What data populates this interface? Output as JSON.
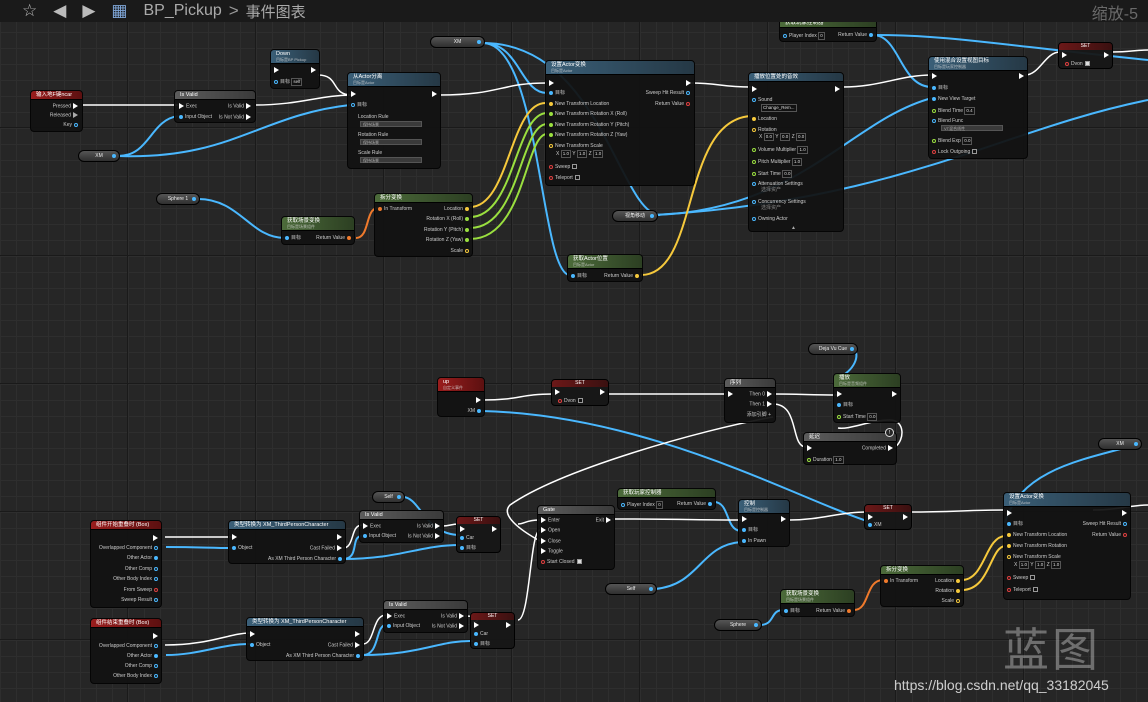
{
  "toolbar": {
    "star_icon": "star-icon",
    "back_icon": "back-arrow-icon",
    "forward_icon": "forward-arrow-icon",
    "bp_icon": "blueprint-icon",
    "title": "BP_Pickup",
    "separator": ">",
    "graph": "事件图表",
    "zoom": "缩放-5"
  },
  "nodes": {
    "key_event": {
      "title": "输入地F键ncar",
      "pressed": "Pressed",
      "released": "Released",
      "key": "Key"
    },
    "is_valid_1": {
      "title": "Is Valid",
      "exec": "Exec",
      "is_valid": "Is Valid",
      "input": "Input Object",
      "not_valid": "Is Not Valid"
    },
    "down": {
      "title": "Down",
      "sub": "目标是BP Pickup",
      "target": "目标",
      "self": "self"
    },
    "attach": {
      "title": "从Actor分离",
      "sub": "目标是Actor",
      "target": "目标",
      "loc_rule": "Location Rule",
      "rot_rule": "Rotation Rule",
      "scale_rule": "Scale Rule",
      "rule_value": "保持场景"
    },
    "set_transform": {
      "title": "设置Actor变换",
      "sub": "目标是Actor",
      "target": "目标",
      "location": "New Transform Location",
      "rot_x": "New Transform Rotation X (Roll)",
      "rot_y": "New Transform Rotation Y (Pitch)",
      "rot_z": "New Transform Rotation Z (Yaw)",
      "scale": "New Transform Scale",
      "scale_x": "1.0",
      "scale_y": "1.0",
      "scale_z": "1.0",
      "sweep": "Sweep",
      "teleport": "Teleport",
      "sweep_hit": "Sweep Hit Result",
      "ret": "Return Value"
    },
    "play_sound": {
      "title": "播放位置处的音效",
      "sound": "Sound",
      "sound_val": "Change_Rem...",
      "location": "Location",
      "rotation": "Rotation",
      "rx": "0.0",
      "ry": "0.0",
      "rz": "0.0",
      "volume": "Volume Multiplier",
      "volume_val": "1.0",
      "pitch": "Pitch Multiplier",
      "pitch_val": "1.0",
      "start": "Start Time",
      "start_val": "0.0",
      "atten": "Attenuation Settings",
      "atten_val": "选择资产",
      "concur": "Concurrency Settings",
      "concur_val": "选择资产",
      "owning": "Owning Actor"
    },
    "get_controller": {
      "title": "获取玩家控制器",
      "player": "Player Index",
      "player_val": "0",
      "ret": "Return Value"
    },
    "set_view_target": {
      "title": "使用混合设置视图目标",
      "sub": "目标是玩家控制器",
      "target": "目标",
      "new_view": "New View Target",
      "blend_time": "Blend Time",
      "blend_val": "0.4",
      "blend_func": "Blend Func",
      "blend_func_val": "VT混合线性",
      "blend_exp": "Blend Exp",
      "blend_exp_val": "0.0",
      "lock": "Lock Outgoing"
    },
    "set_dvon_top": {
      "title": "SET",
      "label": "Dvon"
    },
    "get_world_transform": {
      "title": "获取场景变换",
      "sub": "目标是场景组件",
      "target": "目标",
      "ret": "Return Value"
    },
    "break_transform": {
      "title": "拆分变换",
      "in": "In Transform",
      "location": "Location",
      "rx": "Rotation X (Roll)",
      "ry": "Rotation Y (Pitch)",
      "rz": "Rotation Z (Yaw)",
      "scale": "Scale"
    },
    "get_actor_loc": {
      "title": "获取Actor位置",
      "sub": "目标是Actor",
      "target": "目标",
      "ret": "Return Value"
    },
    "up": {
      "title": "up",
      "sub": "自定义事件",
      "xm": "XM"
    },
    "set_dvon_mid": {
      "title": "SET",
      "label": "Dvon"
    },
    "sequence": {
      "title": "序列",
      "then0": "Then 0",
      "then1": "Then 1",
      "add": "添加引脚"
    },
    "play_sound2": {
      "title": "播放",
      "sub": "目标是音频组件",
      "target": "目标",
      "start": "Start Time",
      "start_val": "0.0"
    },
    "delay": {
      "title": "延迟",
      "duration": "Duration",
      "duration_val": "1.0",
      "completed": "Completed"
    },
    "overlap_begin": {
      "title": "组件开始重叠时 (Box)",
      "comp": "Overlapped Component",
      "other_actor": "Other Actor",
      "other_comp": "Other Comp",
      "body": "Other Body Index",
      "from": "From Sweep",
      "sweep": "Sweep Result"
    },
    "overlap_end": {
      "title": "组件结束重叠时 (Box)",
      "comp": "Overlapped Component",
      "other_actor": "Other Actor",
      "other_comp": "Other Comp",
      "body": "Other Body Index"
    },
    "cast1": {
      "title": "类型转换为 XM_ThirdPersonCharacter",
      "object": "Object",
      "failed": "Cast Failed",
      "as": "As XM Third Person Character"
    },
    "cast2": {
      "title": "类型转换为 XM_ThirdPersonCharacter",
      "object": "Object",
      "failed": "Cast Failed",
      "as": "As XM Third Person Character"
    },
    "is_valid_2": {
      "title": "Is Valid",
      "exec": "Exec",
      "is_valid": "Is Valid",
      "input": "Input Object",
      "not_valid": "Is Not Valid"
    },
    "is_valid_3": {
      "title": "Is Valid",
      "exec": "Exec",
      "is_valid": "Is Valid",
      "input": "Input Object",
      "not_valid": "Is Not Valid"
    },
    "set_car1": {
      "title": "SET",
      "car": "Car",
      "target": "目标"
    },
    "set_car2": {
      "title": "SET",
      "car": "Car",
      "target": "目标"
    },
    "gate": {
      "title": "Gate",
      "enter": "Enter",
      "exit": "Exit",
      "open": "Open",
      "close": "Close",
      "toggle": "Toggle",
      "start_closed": "Start Closed"
    },
    "get_controller2": {
      "title": "获取玩家控制器",
      "player": "Player Index",
      "player_val": "0",
      "ret": "Return Value"
    },
    "possess": {
      "title": "控制",
      "sub": "目标是控制器",
      "target": "目标",
      "pawn": "In Pawn"
    },
    "set_xm": {
      "title": "SET",
      "xm": "XM"
    },
    "set_transform2": {
      "title": "设置Actor变换",
      "sub": "目标是Actor",
      "target": "目标",
      "location": "New Transform Location",
      "rotation": "New Transform Rotation",
      "scale": "New Transform Scale",
      "scale_x": "1.0",
      "scale_y": "1.0",
      "scale_z": "1.0",
      "sweep": "Sweep",
      "teleport": "Teleport",
      "sweep_hit": "Sweep Hit Result",
      "ret": "Return Value"
    },
    "break_transform2": {
      "title": "拆分变换",
      "in": "In Transform",
      "location": "Location",
      "rotation": "Rotation",
      "scale": "Scale"
    },
    "get_world_transform2": {
      "title": "获取场景变换",
      "sub": "目标是场景组件",
      "target": "目标",
      "ret": "Return Value"
    }
  },
  "vars": {
    "xm_top": "XM",
    "xm_left": "XM",
    "sphere1": "Sphere 1",
    "camera": "视角移动",
    "deja": "Deja Vu Cue",
    "self1": "Self",
    "self2": "Self",
    "sphere": "Sphere",
    "xm_right": "XM"
  },
  "watermark": "蓝图",
  "url": "https://blog.csdn.net/qq_33182045",
  "colors": {
    "exec": "#ffffff",
    "object": "#4ab8ff",
    "vector": "#f6c93c",
    "float": "#9adf3f",
    "transform": "#f07a2c",
    "bool": "#e04040"
  }
}
